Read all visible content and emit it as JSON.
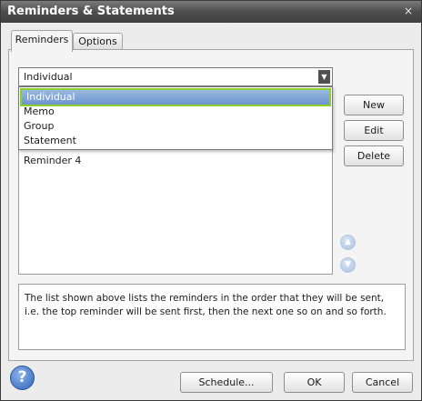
{
  "window": {
    "title": "Reminders & Statements",
    "close_glyph": "×"
  },
  "tabs": [
    {
      "label": "Reminders",
      "active": true
    },
    {
      "label": "Options",
      "active": false
    }
  ],
  "combo": {
    "value": "Individual",
    "arrow_glyph": "▼"
  },
  "dropdown": {
    "options": [
      "Individual",
      "Memo",
      "Group",
      "Statement"
    ],
    "selected": "Individual"
  },
  "list": {
    "visible_items": [
      "Reminder 4"
    ]
  },
  "buttons": {
    "new": "New",
    "edit": "Edit",
    "delete": "Delete",
    "schedule": "Schedule...",
    "ok": "OK",
    "cancel": "Cancel"
  },
  "move_up_glyph": "▲",
  "move_down_glyph": "▼",
  "description": "The list shown above lists the reminders in the order that they will be sent, i.e. the top reminder will be sent first, then the next one so on and so forth.",
  "help_glyph": "?",
  "colors": {
    "selection": "#7aa0d6",
    "selection_border": "#8bd12c",
    "titlebar": "#4e4e4e",
    "help": "#2f64b8"
  }
}
